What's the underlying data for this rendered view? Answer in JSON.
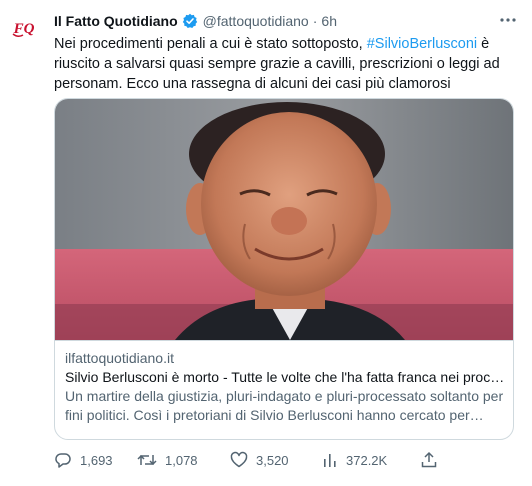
{
  "tweet": {
    "author_name": "Il Fatto Quotidiano",
    "handle": "@fattoquotidiano",
    "separator": "·",
    "time": "6h",
    "text_part1": "Nei procedimenti penali a cui è stato sottoposto, ",
    "hashtag": "#SilvioBerlusconi",
    "text_part2": " è riuscito a salvarsi quasi sempre grazie a cavilli, prescrizioni o leggi ad personam. Ecco una rassegna di alcuni dei casi più clamorosi",
    "avatar_text": "FQ"
  },
  "card": {
    "domain": "ilfattoquotidiano.it",
    "title": "Silvio Berlusconi è morto - Tutte le volte che l'ha fatta franca nei procedimenti penali",
    "description": "Un martire della giustizia, pluri-indagato e pluri-processato soltanto per fini politici. Così i pretoriani di Silvio Berlusconi hanno cercato per…"
  },
  "actions": {
    "replies": "1,693",
    "retweets": "1,078",
    "likes": "3,520",
    "views": "372.2K"
  },
  "colors": {
    "accent": "#1d9bf0",
    "text": "#0f1419",
    "muted": "#536471",
    "border": "#cfd9de",
    "logo_red": "#c8102e"
  },
  "icons": {
    "avatar": "fq-logo-icon",
    "verified": "verified-badge-icon",
    "more": "more-dots-icon",
    "reply": "reply-icon",
    "retweet": "retweet-icon",
    "like": "heart-icon",
    "views": "views-bar-icon",
    "share": "share-icon"
  }
}
